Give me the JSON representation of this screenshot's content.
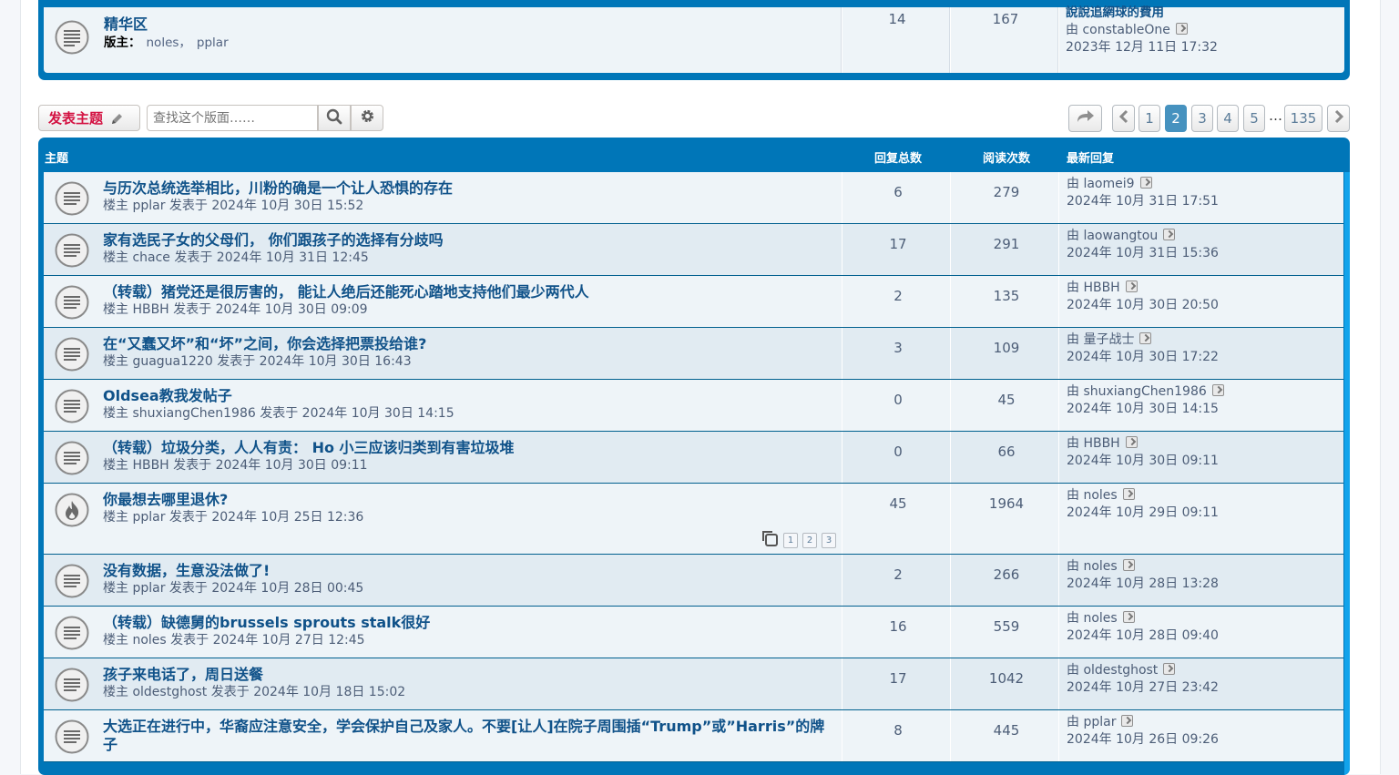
{
  "forum": {
    "title": "精华区",
    "mods_label": "版主：",
    "mods": [
      "noles，",
      "pplar"
    ],
    "topics": "14",
    "posts": "167",
    "last_title": "說說追網球的費用",
    "last_by": "由",
    "last_user": "constableOne",
    "last_time": "2023年 12月 11日 17:32"
  },
  "actions": {
    "post_label": "发表主题",
    "search_placeholder": "查找这个版面……"
  },
  "pagination": {
    "pages": [
      "1",
      "2",
      "3",
      "4",
      "5"
    ],
    "current": "2",
    "ellipsis": "…",
    "last": "135"
  },
  "table": {
    "col_topic": "主题",
    "col_replies": "回复总数",
    "col_views": "阅读次数",
    "col_last": "最新回复"
  },
  "topics": [
    {
      "title": "与历次总统选举相比，川粉的确是一个让人恐惧的存在",
      "meta": "楼主 pplar 发表于 2024年 10月 30日 15:52",
      "replies": "6",
      "views": "279",
      "last": "由 laomei9",
      "last_time": "2024年 10月 31日 17:51",
      "icon": "topic"
    },
    {
      "title": "家有选民子女的父母们， 你们跟孩子的选择有分歧吗",
      "meta": "楼主 chace 发表于 2024年 10月 31日 12:45",
      "replies": "17",
      "views": "291",
      "last": "由 laowangtou",
      "last_time": "2024年 10月 31日 15:36",
      "icon": "topic"
    },
    {
      "title": "（转载）猪党还是很厉害的， 能让人绝后还能死心踏地支持他们最少两代人",
      "meta": "楼主 HBBH 发表于 2024年 10月 30日 09:09",
      "replies": "2",
      "views": "135",
      "last": "由 HBBH",
      "last_time": "2024年 10月 30日 20:50",
      "icon": "topic"
    },
    {
      "title": "在“又蠢又坏”和“坏”之间，你会选择把票投给谁?",
      "meta": "楼主 guagua1220 发表于 2024年 10月 30日 16:43",
      "replies": "3",
      "views": "109",
      "last": "由 量子战士",
      "last_time": "2024年 10月 30日 17:22",
      "icon": "topic"
    },
    {
      "title": "Oldsea教我发帖子",
      "meta": "楼主 shuxiangChen1986 发表于 2024年 10月 30日 14:15",
      "replies": "0",
      "views": "45",
      "last": "由 shuxiangChen1986",
      "last_time": "2024年 10月 30日 14:15",
      "icon": "topic"
    },
    {
      "title": "（转载）垃圾分类，人人有责： Ho 小三应该归类到有害垃圾堆",
      "meta": "楼主 HBBH 发表于 2024年 10月 30日 09:11",
      "replies": "0",
      "views": "66",
      "last": "由 HBBH",
      "last_time": "2024年 10月 30日 09:11",
      "icon": "topic"
    },
    {
      "title": "你最想去哪里退休?",
      "meta": "楼主 pplar 发表于 2024年 10月 25日 12:36",
      "replies": "45",
      "views": "1964",
      "last": "由 noles",
      "last_time": "2024年 10月 29日 09:11",
      "icon": "hot",
      "pages": [
        "1",
        "2",
        "3"
      ]
    },
    {
      "title": "没有数据，生意没法做了!",
      "meta": "楼主 pplar 发表于 2024年 10月 28日 00:45",
      "replies": "2",
      "views": "266",
      "last": "由 noles",
      "last_time": "2024年 10月 28日 13:28",
      "icon": "topic"
    },
    {
      "title": "（转载）缺德舅的brussels sprouts stalk很好",
      "meta": "楼主 noles 发表于 2024年 10月 27日 12:45",
      "replies": "16",
      "views": "559",
      "last": "由 noles",
      "last_time": "2024年 10月 28日 09:40",
      "icon": "topic"
    },
    {
      "title": "孩子来电话了，周日送餐",
      "meta": "楼主 oldestghost 发表于 2024年 10月 18日 15:02",
      "replies": "17",
      "views": "1042",
      "last": "由 oldestghost",
      "last_time": "2024年 10月 27日 23:42",
      "icon": "topic"
    },
    {
      "title": "大选正在进行中，华裔应注意安全，学会保护自己及家人。不要[让人]在院子周围插“Trump”或”Harris”的牌",
      "title2": "子",
      "meta": "",
      "replies": "8",
      "views": "445",
      "last": "由 pplar",
      "last_time": "2024年 10月 26日 09:26",
      "icon": "topic"
    }
  ]
}
